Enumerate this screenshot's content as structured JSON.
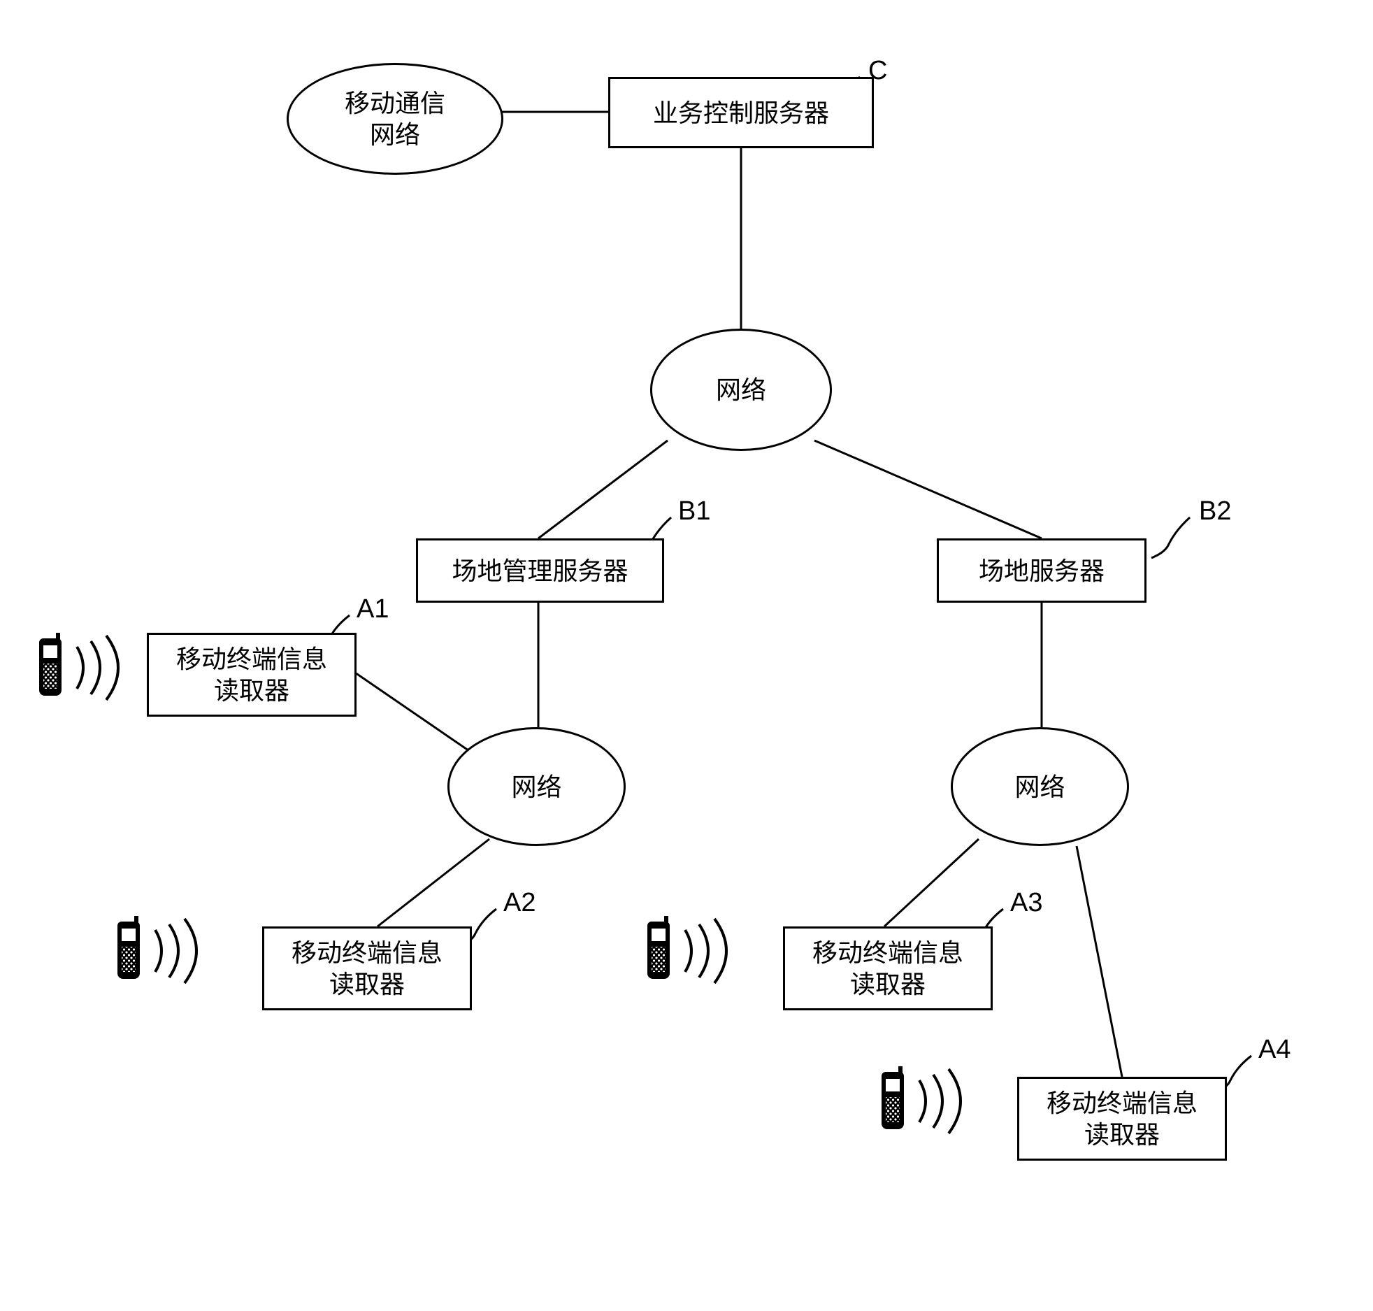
{
  "nodes": {
    "mobile_comm_network": "移动通信\n网络",
    "service_control_server": "业务控制服务器",
    "network": "网络",
    "site_mgmt_server_b1": "场地管理服务器",
    "site_server_b2": "场地服务器",
    "reader_a1": "移动终端信息\n读取器",
    "reader_a2": "移动终端信息\n读取器",
    "reader_a3": "移动终端信息\n读取器",
    "reader_a4": "移动终端信息\n读取器"
  },
  "labels": {
    "c": "C",
    "b1": "B1",
    "b2": "B2",
    "a1": "A1",
    "a2": "A2",
    "a3": "A3",
    "a4": "A4"
  }
}
